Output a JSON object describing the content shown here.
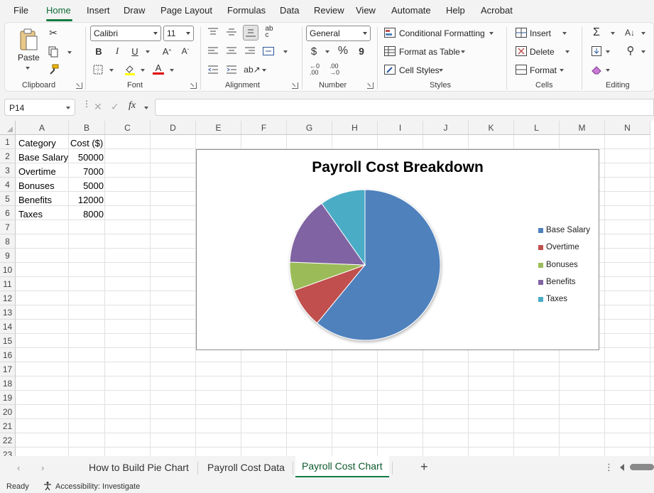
{
  "menu": {
    "items": [
      "File",
      "Home",
      "Insert",
      "Draw",
      "Page Layout",
      "Formulas",
      "Data",
      "Review",
      "View",
      "Automate",
      "Help",
      "Acrobat"
    ],
    "active": "Home"
  },
  "ribbon": {
    "clipboard": {
      "paste_label": "Paste",
      "group_label": "Clipboard"
    },
    "font": {
      "font_name": "Calibri",
      "font_size": "11",
      "group_label": "Font"
    },
    "alignment": {
      "group_label": "Alignment"
    },
    "number": {
      "format": "General",
      "group_label": "Number",
      "currency": "$",
      "percent": "%",
      "comma": "9"
    },
    "styles": {
      "conditional_formatting": "Conditional Formatting",
      "format_as_table": "Format as Table",
      "cell_styles": "Cell Styles",
      "group_label": "Styles"
    },
    "cells": {
      "insert": "Insert",
      "delete": "Delete",
      "format": "Format",
      "group_label": "Cells"
    },
    "editing": {
      "group_label": "Editing"
    }
  },
  "formula_bar": {
    "name_box": "P14",
    "fx": "fx",
    "value": ""
  },
  "grid": {
    "columns": [
      "A",
      "B",
      "C",
      "D",
      "E",
      "F",
      "G",
      "H",
      "I",
      "J",
      "K",
      "L",
      "M",
      "N"
    ],
    "rows": [
      "1",
      "2",
      "3",
      "4",
      "5",
      "6",
      "7",
      "8",
      "9",
      "10",
      "11",
      "12",
      "13",
      "14",
      "15",
      "16",
      "17",
      "18",
      "19",
      "20",
      "21",
      "22",
      "23"
    ],
    "cells": {
      "A1": "Category",
      "B1": "Cost ($)",
      "A2": "Base Salary",
      "B2": "50000",
      "A3": "Overtime",
      "B3": "7000",
      "A4": "Bonuses",
      "B4": "5000",
      "A5": "Benefits",
      "B5": "12000",
      "A6": "Taxes",
      "B6": "8000"
    }
  },
  "chart_data": {
    "type": "pie",
    "title": "Payroll Cost Breakdown",
    "categories": [
      "Base Salary",
      "Overtime",
      "Bonuses",
      "Benefits",
      "Taxes"
    ],
    "values": [
      50000,
      7000,
      5000,
      12000,
      8000
    ],
    "colors": [
      "#4f81bd",
      "#c0504d",
      "#9bbb59",
      "#8064a2",
      "#4bacc6"
    ],
    "legend_position": "right"
  },
  "sheet_tabs": {
    "tabs": [
      "How to Build Pie Chart",
      "Payroll Cost Data",
      "Payroll Cost Chart"
    ],
    "active": "Payroll Cost Chart",
    "add": "+"
  },
  "status_bar": {
    "ready": "Ready",
    "accessibility": "Accessibility: Investigate"
  },
  "accent_color": "#107c41"
}
